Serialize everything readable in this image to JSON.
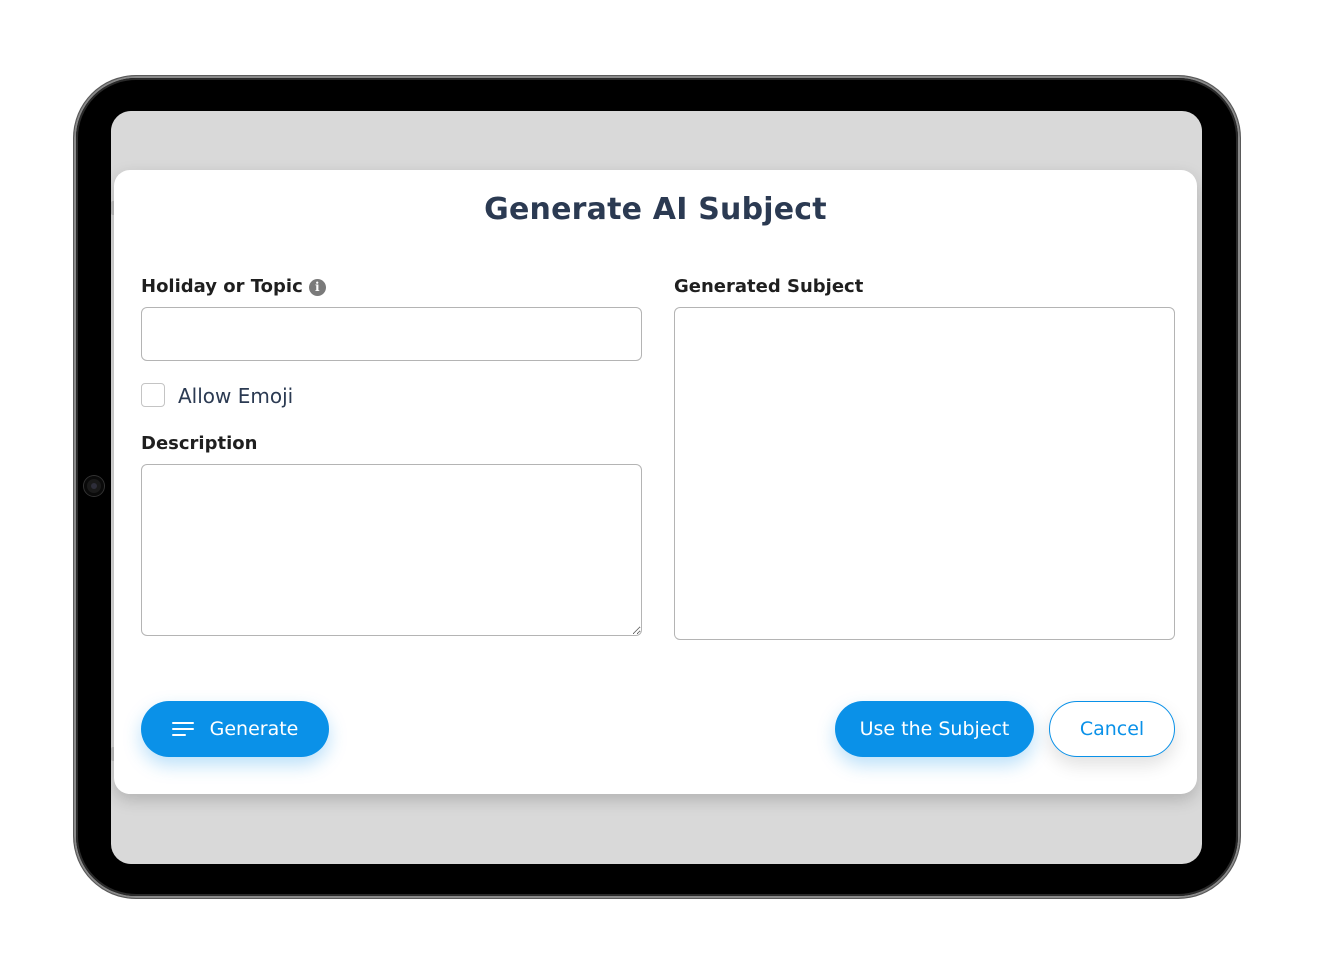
{
  "dialog": {
    "title": "Generate AI Subject"
  },
  "form": {
    "topic_label": "Holiday or Topic",
    "topic_value": "",
    "info_icon": "info-icon",
    "allow_emoji_label": "Allow Emoji",
    "allow_emoji_checked": false,
    "description_label": "Description",
    "description_value": "",
    "generated_label": "Generated Subject",
    "generated_value": ""
  },
  "actions": {
    "generate_label": "Generate",
    "generate_icon": "menu-lines-icon",
    "use_label": "Use the Subject",
    "cancel_label": "Cancel"
  },
  "colors": {
    "accent": "#0a91e8",
    "title": "#2b3a52",
    "backdrop": "#d9d9d9"
  }
}
